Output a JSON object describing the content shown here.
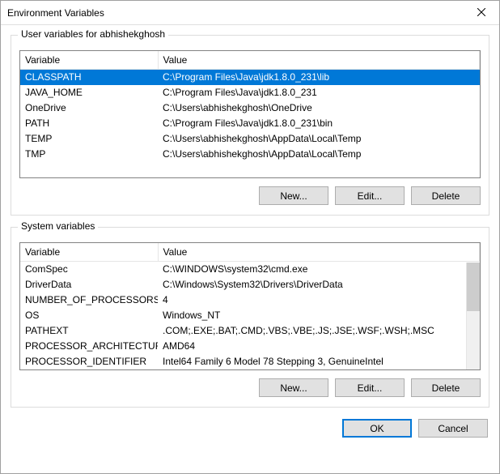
{
  "window": {
    "title": "Environment Variables"
  },
  "user_group": {
    "legend": "User variables for abhishekghosh",
    "headers": {
      "variable": "Variable",
      "value": "Value"
    },
    "rows": [
      {
        "variable": "CLASSPATH",
        "value": "C:\\Program Files\\Java\\jdk1.8.0_231\\lib",
        "selected": true
      },
      {
        "variable": "JAVA_HOME",
        "value": "C:\\Program Files\\Java\\jdk1.8.0_231"
      },
      {
        "variable": "OneDrive",
        "value": "C:\\Users\\abhishekghosh\\OneDrive"
      },
      {
        "variable": "PATH",
        "value": "C:\\Program Files\\Java\\jdk1.8.0_231\\bin"
      },
      {
        "variable": "TEMP",
        "value": "C:\\Users\\abhishekghosh\\AppData\\Local\\Temp"
      },
      {
        "variable": "TMP",
        "value": "C:\\Users\\abhishekghosh\\AppData\\Local\\Temp"
      }
    ],
    "buttons": {
      "new": "New...",
      "edit": "Edit...",
      "delete": "Delete"
    }
  },
  "system_group": {
    "legend": "System variables",
    "headers": {
      "variable": "Variable",
      "value": "Value"
    },
    "rows": [
      {
        "variable": "ComSpec",
        "value": "C:\\WINDOWS\\system32\\cmd.exe"
      },
      {
        "variable": "DriverData",
        "value": "C:\\Windows\\System32\\Drivers\\DriverData"
      },
      {
        "variable": "NUMBER_OF_PROCESSORS",
        "value": "4"
      },
      {
        "variable": "OS",
        "value": "Windows_NT"
      },
      {
        "variable": "PATHEXT",
        "value": ".COM;.EXE;.BAT;.CMD;.VBS;.VBE;.JS;.JSE;.WSF;.WSH;.MSC"
      },
      {
        "variable": "PROCESSOR_ARCHITECTURE",
        "value": "AMD64"
      },
      {
        "variable": "PROCESSOR_IDENTIFIER",
        "value": "Intel64 Family 6 Model 78 Stepping 3, GenuineIntel"
      }
    ],
    "buttons": {
      "new": "New...",
      "edit": "Edit...",
      "delete": "Delete"
    }
  },
  "dialog_buttons": {
    "ok": "OK",
    "cancel": "Cancel"
  }
}
